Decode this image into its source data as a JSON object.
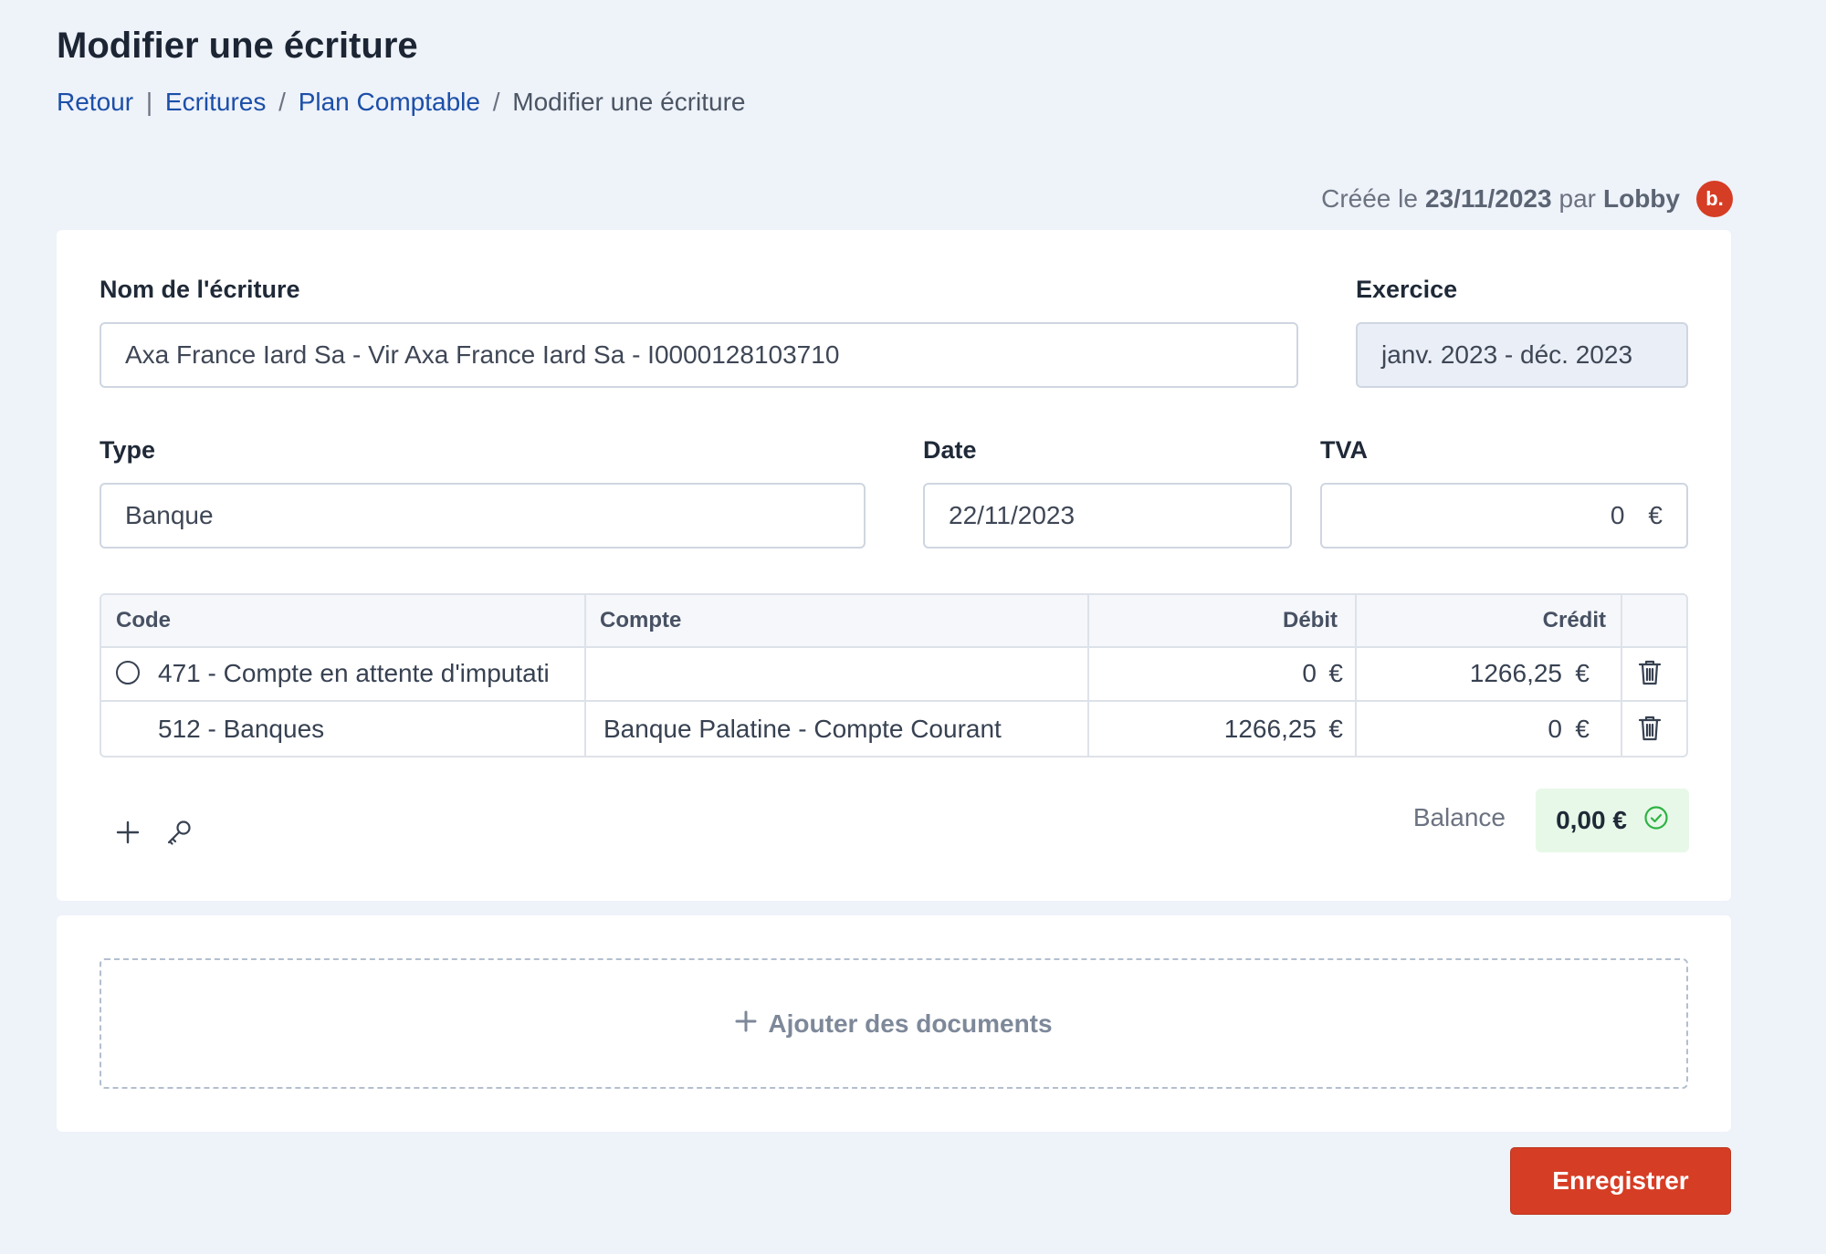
{
  "page": {
    "title": "Modifier une écriture",
    "breadcrumb": {
      "back": "Retour",
      "sep1": "|",
      "item1": "Ecritures",
      "sep2": "/",
      "item2": "Plan Comptable",
      "sep3": "/",
      "current": "Modifier une écriture"
    },
    "meta": {
      "prefix": "Créée le",
      "date": "23/11/2023",
      "by": "par",
      "author": "Lobby",
      "avatar": "b."
    }
  },
  "form": {
    "name_label": "Nom de l'écriture",
    "name_value": "Axa France Iard Sa - Vir Axa France Iard Sa - I0000128103710",
    "exercice_label": "Exercice",
    "exercice_value": "janv. 2023 - déc. 2023",
    "type_label": "Type",
    "type_value": "Banque",
    "date_label": "Date",
    "date_value": "22/11/2023",
    "tva_label": "TVA",
    "tva_value": "0",
    "tva_unit": "€"
  },
  "table": {
    "headers": {
      "code": "Code",
      "compte": "Compte",
      "debit": "Débit",
      "credit": "Crédit"
    },
    "rows": [
      {
        "code": "471 - Compte en attente d'imputati",
        "compte": "",
        "debit": "0",
        "credit": "1266,25",
        "unit": "€"
      },
      {
        "code": "512 - Banques",
        "compte": "Banque Palatine - Compte Courant",
        "debit": "1266,25",
        "credit": "0",
        "unit": "€"
      }
    ]
  },
  "balance": {
    "label": "Balance",
    "value": "0,00 €",
    "status_color": "#2fb344"
  },
  "documents": {
    "add_label": "Ajouter des documents"
  },
  "actions": {
    "save_label": "Enregistrer"
  },
  "colors": {
    "accent": "#d63d25",
    "link": "#1b4fa8",
    "background": "#eef2f9"
  },
  "icons": [
    "plus-icon",
    "key-icon",
    "trash-icon",
    "check-circle-icon",
    "radio-icon"
  ]
}
